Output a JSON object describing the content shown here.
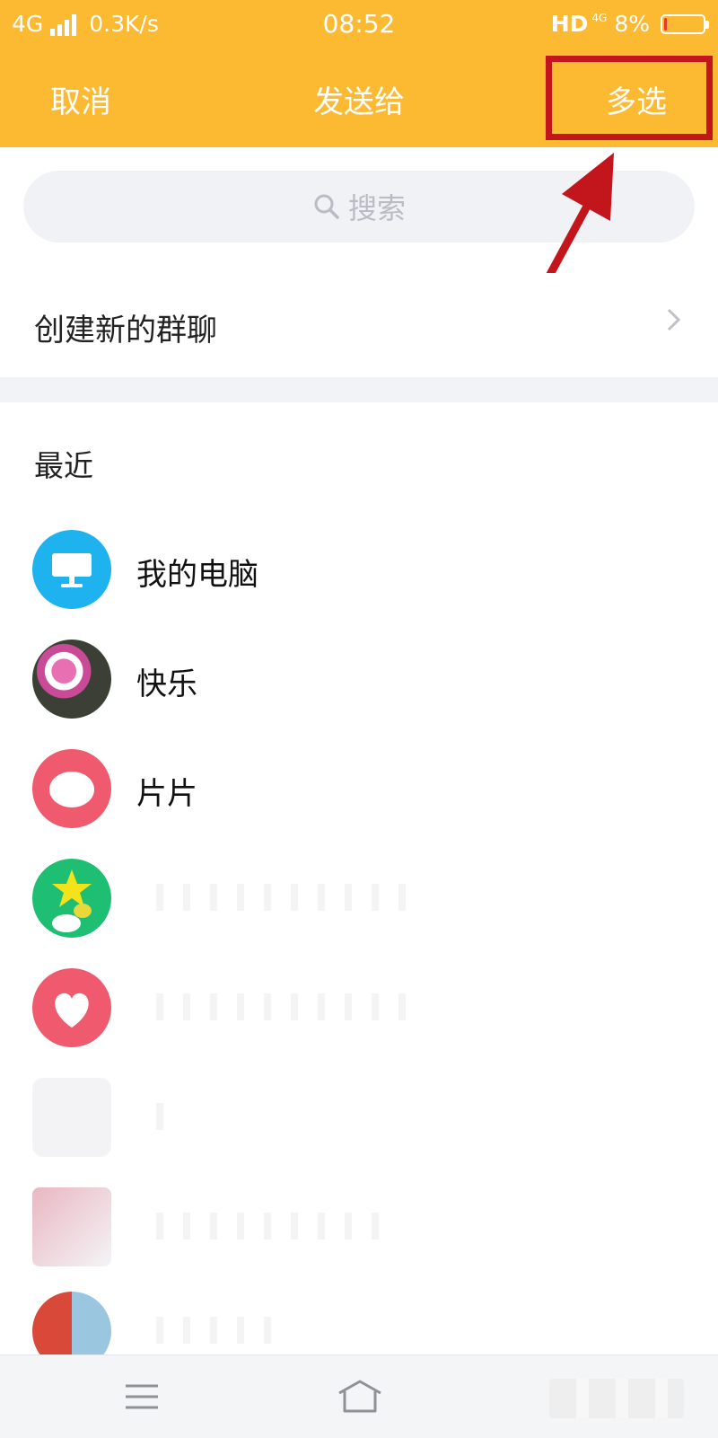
{
  "status_bar": {
    "network": "4G",
    "speed": "0.3K/s",
    "time": "08:52",
    "hd": "HD",
    "network_right": "4G",
    "battery_percent": "8%",
    "battery_level": 0.08
  },
  "title_bar": {
    "cancel_label": "取消",
    "title": "发送给",
    "multi_select_label": "多选",
    "annotation_color": "#c3161c"
  },
  "search": {
    "placeholder": "搜索"
  },
  "create_group": {
    "label": "创建新的群聊"
  },
  "recent": {
    "section_label": "最近",
    "contacts": [
      {
        "name": "我的电脑",
        "avatar": "computer-icon"
      },
      {
        "name": "快乐",
        "avatar": "photo-flowers"
      },
      {
        "name": "片片",
        "avatar": "heart-icon"
      },
      {
        "name": "",
        "avatar": "star-icon"
      },
      {
        "name": "",
        "avatar": "heart-icon"
      },
      {
        "name": "",
        "avatar": "photo"
      },
      {
        "name": "",
        "avatar": "photo"
      },
      {
        "name": "",
        "avatar": "photo"
      }
    ]
  },
  "colors": {
    "header": "#fcb932",
    "computer_avatar": "#1eb3ee",
    "heart_avatar": "#f05a6f",
    "star_avatar": "#1fbf73"
  }
}
